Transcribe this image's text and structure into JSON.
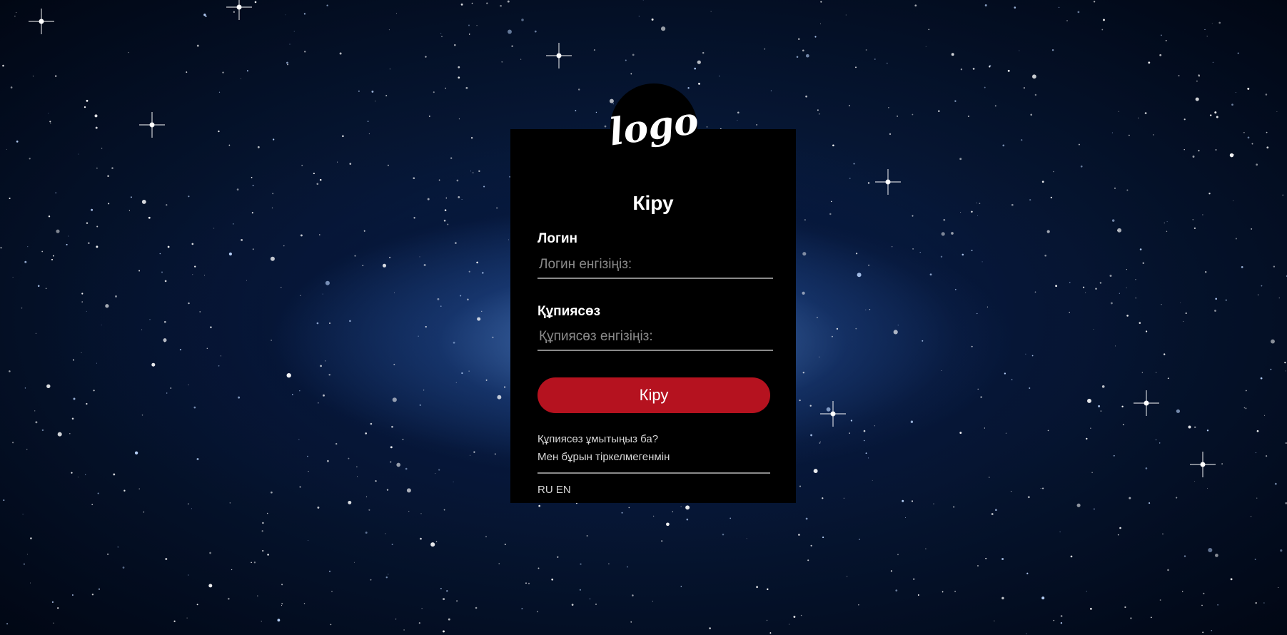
{
  "logo": {
    "text": "logo"
  },
  "login_form": {
    "title": "Кіру",
    "login_label": "Логин",
    "login_placeholder": "Логин енгізіңіз:",
    "login_value": "",
    "password_label": "Құпиясөз",
    "password_placeholder": "Құпиясөз енгізіңіз:",
    "password_value": "",
    "submit_label": "Кіру",
    "forgot_password_link": "Құпиясөз ұмытыңыз ба?",
    "register_link": "Мен бұрын тіркелмегенмін",
    "languages": [
      "RU",
      "EN"
    ]
  },
  "colors": {
    "card_background": "#000000",
    "submit_button": "#b5121f",
    "input_underline": "#8a8a8a",
    "page_background": "#061633"
  }
}
